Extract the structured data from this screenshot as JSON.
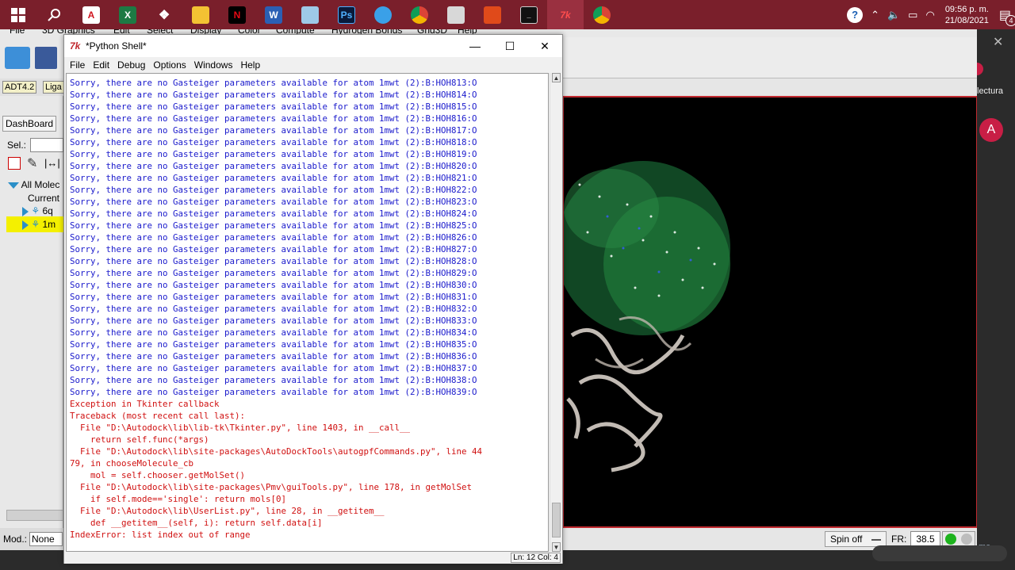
{
  "taskbar": {
    "icons": [
      "windows-start-icon",
      "search-icon",
      "acrobat-icon",
      "excel-icon",
      "dropbox-icon",
      "file-explorer-icon",
      "netflix-icon",
      "word-icon",
      "notes-icon",
      "photoshop-icon",
      "lightbulb-icon",
      "chrome-icon",
      "control-panel-icon",
      "office-icon",
      "terminal-icon",
      "tk-icon",
      "chrome-profile-icon"
    ],
    "icon_labels": {
      "acrobat": "A",
      "excel": "X",
      "netflix": "N",
      "word": "W",
      "photoshop": "Ps"
    },
    "clock_time": "09:56 p. m.",
    "clock_date": "21/08/2021",
    "notification_count": "4",
    "help": "?"
  },
  "background_app": {
    "menu": [
      "File",
      "3D Graphics",
      "Edit",
      "Select",
      "Display",
      "Color",
      "Compute",
      "Hydrogen Bonds",
      "Grid3D",
      "Help"
    ],
    "adt_tag": "ADT4.2",
    "liga_tag": "Liga",
    "dashboard_tab": "DashBoard",
    "sel_label": "Sel.:",
    "tree_all": "All Molec",
    "tree_current": "Current",
    "tree_item1": "6q",
    "tree_item2": "1m",
    "mod_label": "Mod.:",
    "mod_value": "None",
    "spin_label": "Spin off",
    "fr_label": "FR:",
    "fr_value": "38.5"
  },
  "browser_edge": {
    "lectura": "lectura",
    "avatar": "A",
    "me": "me"
  },
  "shell": {
    "title": "*Python Shell*",
    "menu": [
      "File",
      "Edit",
      "Debug",
      "Options",
      "Windows",
      "Help"
    ],
    "status_position": "Ln: 12 Col: 4",
    "lines": [
      {
        "text": "Sorry, there are no Gasteiger parameters available for atom 1mwt (2):B:HOH813:O",
        "color": "blue"
      },
      {
        "text": "Sorry, there are no Gasteiger parameters available for atom 1mwt (2):B:HOH814:O",
        "color": "blue"
      },
      {
        "text": "Sorry, there are no Gasteiger parameters available for atom 1mwt (2):B:HOH815:O",
        "color": "blue"
      },
      {
        "text": "Sorry, there are no Gasteiger parameters available for atom 1mwt (2):B:HOH816:O",
        "color": "blue"
      },
      {
        "text": "Sorry, there are no Gasteiger parameters available for atom 1mwt (2):B:HOH817:O",
        "color": "blue"
      },
      {
        "text": "Sorry, there are no Gasteiger parameters available for atom 1mwt (2):B:HOH818:O",
        "color": "blue"
      },
      {
        "text": "Sorry, there are no Gasteiger parameters available for atom 1mwt (2):B:HOH819:O",
        "color": "blue"
      },
      {
        "text": "Sorry, there are no Gasteiger parameters available for atom 1mwt (2):B:HOH820:O",
        "color": "blue"
      },
      {
        "text": "Sorry, there are no Gasteiger parameters available for atom 1mwt (2):B:HOH821:O",
        "color": "blue"
      },
      {
        "text": "Sorry, there are no Gasteiger parameters available for atom 1mwt (2):B:HOH822:O",
        "color": "blue"
      },
      {
        "text": "Sorry, there are no Gasteiger parameters available for atom 1mwt (2):B:HOH823:O",
        "color": "blue"
      },
      {
        "text": "Sorry, there are no Gasteiger parameters available for atom 1mwt (2):B:HOH824:O",
        "color": "blue"
      },
      {
        "text": "Sorry, there are no Gasteiger parameters available for atom 1mwt (2):B:HOH825:O",
        "color": "blue"
      },
      {
        "text": "Sorry, there are no Gasteiger parameters available for atom 1mwt (2):B:HOH826:O",
        "color": "blue"
      },
      {
        "text": "Sorry, there are no Gasteiger parameters available for atom 1mwt (2):B:HOH827:O",
        "color": "blue"
      },
      {
        "text": "Sorry, there are no Gasteiger parameters available for atom 1mwt (2):B:HOH828:O",
        "color": "blue"
      },
      {
        "text": "Sorry, there are no Gasteiger parameters available for atom 1mwt (2):B:HOH829:O",
        "color": "blue"
      },
      {
        "text": "Sorry, there are no Gasteiger parameters available for atom 1mwt (2):B:HOH830:O",
        "color": "blue"
      },
      {
        "text": "Sorry, there are no Gasteiger parameters available for atom 1mwt (2):B:HOH831:O",
        "color": "blue"
      },
      {
        "text": "Sorry, there are no Gasteiger parameters available for atom 1mwt (2):B:HOH832:O",
        "color": "blue"
      },
      {
        "text": "Sorry, there are no Gasteiger parameters available for atom 1mwt (2):B:HOH833:O",
        "color": "blue"
      },
      {
        "text": "Sorry, there are no Gasteiger parameters available for atom 1mwt (2):B:HOH834:O",
        "color": "blue"
      },
      {
        "text": "Sorry, there are no Gasteiger parameters available for atom 1mwt (2):B:HOH835:O",
        "color": "blue"
      },
      {
        "text": "Sorry, there are no Gasteiger parameters available for atom 1mwt (2):B:HOH836:O",
        "color": "blue"
      },
      {
        "text": "Sorry, there are no Gasteiger parameters available for atom 1mwt (2):B:HOH837:O",
        "color": "blue"
      },
      {
        "text": "Sorry, there are no Gasteiger parameters available for atom 1mwt (2):B:HOH838:O",
        "color": "blue"
      },
      {
        "text": "Sorry, there are no Gasteiger parameters available for atom 1mwt (2):B:HOH839:O",
        "color": "blue"
      },
      {
        "text": "Exception in Tkinter callback",
        "color": "red"
      },
      {
        "text": "Traceback (most recent call last):",
        "color": "red"
      },
      {
        "text": "  File \"D:\\Autodock\\lib\\lib-tk\\Tkinter.py\", line 1403, in __call__",
        "color": "red"
      },
      {
        "text": "    return self.func(*args)",
        "color": "red"
      },
      {
        "text": "  File \"D:\\Autodock\\lib\\site-packages\\AutoDockTools\\autogpfCommands.py\", line 44",
        "color": "red"
      },
      {
        "text": "79, in chooseMolecule_cb",
        "color": "red"
      },
      {
        "text": "    mol = self.chooser.getMolSet()",
        "color": "red"
      },
      {
        "text": "  File \"D:\\Autodock\\lib\\site-packages\\Pmv\\guiTools.py\", line 178, in getMolSet",
        "color": "red"
      },
      {
        "text": "    if self.mode=='single': return mols[0]",
        "color": "red"
      },
      {
        "text": "  File \"D:\\Autodock\\lib\\UserList.py\", line 28, in __getitem__",
        "color": "red"
      },
      {
        "text": "    def __getitem__(self, i): return self.data[i]",
        "color": "red"
      },
      {
        "text": "IndexError: list index out of range",
        "color": "red"
      }
    ]
  },
  "colors": {
    "taskbar": "#7a1f2b",
    "stdout_blue": "#1a1acc",
    "stderr_red": "#d01010",
    "viewer_border": "#c0282e"
  }
}
